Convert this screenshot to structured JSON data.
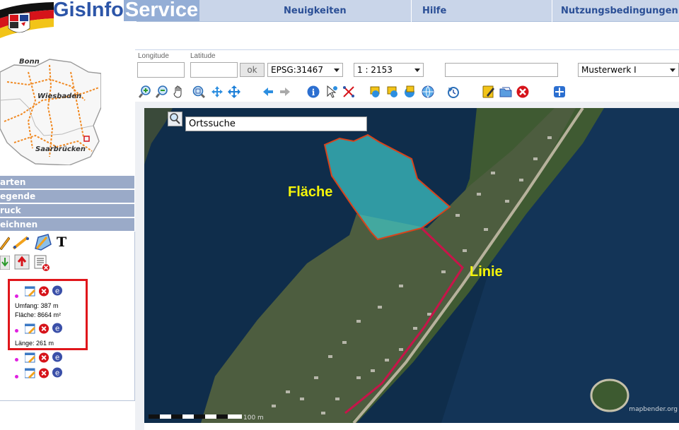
{
  "header": {
    "title_part1": "GisInfo",
    "title_part2": "Service",
    "nav": [
      "Neuigkeiten",
      "Hilfe",
      "Nutzungsbedingungen"
    ]
  },
  "overview": {
    "cities": [
      "Bonn",
      "Wiesbaden",
      "Saarbrücken"
    ]
  },
  "sidemenu": {
    "items": [
      "arten",
      "egende",
      "ruck",
      "eichnen"
    ]
  },
  "toolbar": {
    "longitude_label": "Longitude",
    "latitude_label": "Latitude",
    "ok_label": "ok",
    "epsg_value": "EPSG:31467",
    "scale_value": "1 : 2153",
    "werk_value": "Musterwerk I",
    "search_value": ""
  },
  "map": {
    "search_placeholder": "Ortssuche",
    "label_flaeche": "Fläche",
    "label_linie": "Linie",
    "scalebar_label": "100 m",
    "copyright": "mapbender.org"
  },
  "draw": {
    "text_tool": "T",
    "entries": [
      {
        "lines": [
          "Umfang: 387 m",
          "Fläche: 8664 m²"
        ]
      },
      {
        "lines": [
          "Länge: 261 m"
        ]
      },
      {
        "lines": []
      },
      {
        "lines": []
      }
    ]
  },
  "colors": {
    "accent": "#2c55a8",
    "nav_bg": "#c9d5e9",
    "menu_bg": "#9aaac8",
    "highlight": "#e0161b",
    "polygon_fill": "#3fc9c9",
    "line_color": "#c8144a",
    "label_yellow": "#f4f40a"
  }
}
